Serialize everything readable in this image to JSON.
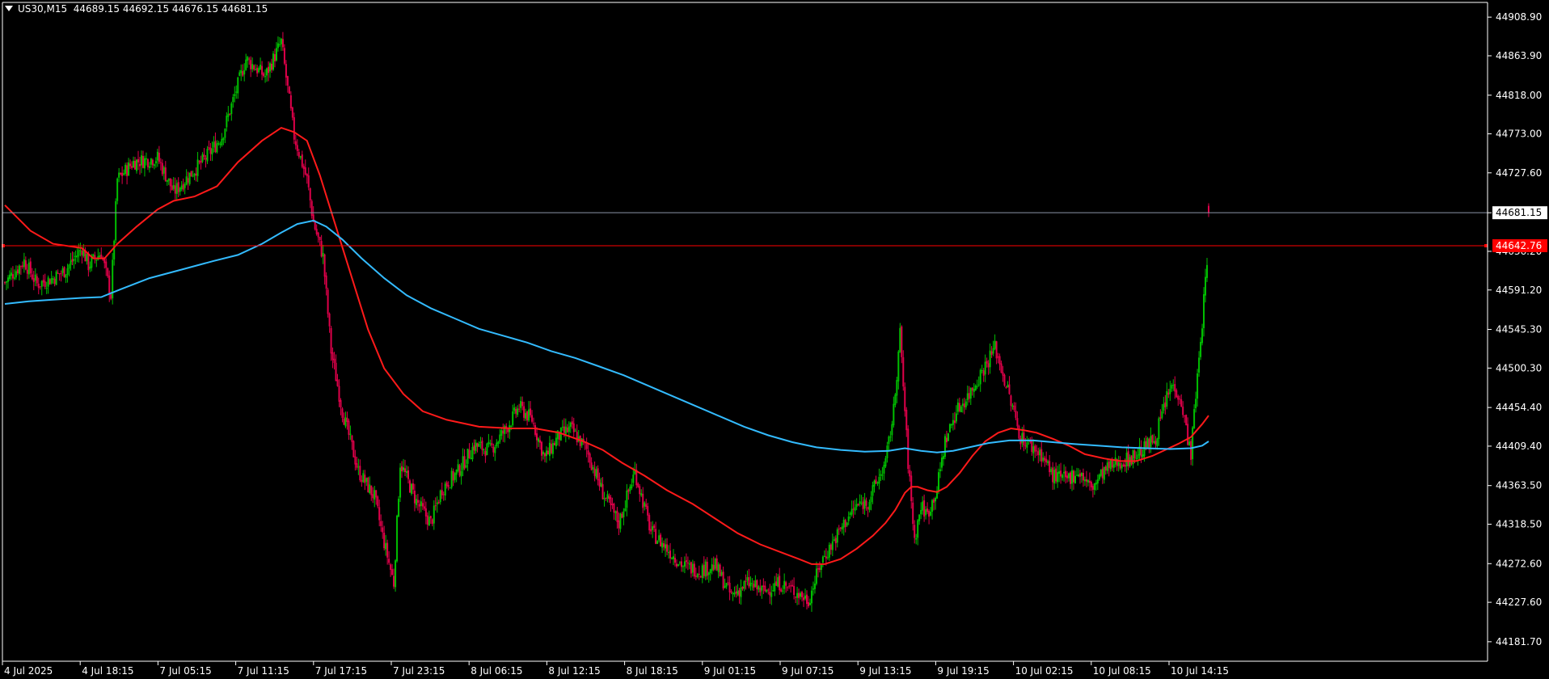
{
  "header": {
    "symbol_timeframe": "US30,M15",
    "ohlc": "44689.15 44692.15 44676.15 44681.15"
  },
  "colors": {
    "background": "#000000",
    "axis": "#ffffff",
    "bull": "#00c000",
    "bear": "#e0004a",
    "ma_fast": "#ff1a1a",
    "ma_slow": "#33bbff",
    "bid_line": "#8b95a8",
    "ask_line": "#ff0000",
    "bid_badge_bg": "#ffffff",
    "bid_badge_text": "#000000",
    "ask_badge_bg": "#ff0000",
    "ask_badge_text": "#ffffff"
  },
  "chart_data": {
    "type": "candlestick",
    "grid": false,
    "ylim": [
      44159.0,
      44926.0
    ],
    "y_ticks": [
      "44908.90",
      "44863.90",
      "44818.00",
      "44773.00",
      "44727.60",
      "44681.15",
      "44636.20",
      "44591.20",
      "44545.30",
      "44500.30",
      "44454.40",
      "44409.40",
      "44363.50",
      "44318.50",
      "44272.60",
      "44227.60",
      "44181.70"
    ],
    "x_ticks": [
      "4 Jul 2025",
      "4 Jul 18:15",
      "7 Jul 05:15",
      "7 Jul 11:15",
      "7 Jul 17:15",
      "7 Jul 23:15",
      "8 Jul 06:15",
      "8 Jul 12:15",
      "8 Jul 18:15",
      "9 Jul 01:15",
      "9 Jul 07:15",
      "9 Jul 13:15",
      "9 Jul 19:15",
      "10 Jul 02:15",
      "10 Jul 08:15",
      "10 Jul 14:15"
    ],
    "bid_price": "44681.15",
    "ask_price": "44642.76",
    "last_candle": {
      "open": 44689.15,
      "high": 44692.15,
      "low": 44676.15,
      "close": 44681.15
    },
    "close_anchors": [
      [
        0,
        44600
      ],
      [
        12,
        44625
      ],
      [
        20,
        44598
      ],
      [
        30,
        44605
      ],
      [
        38,
        44615
      ],
      [
        48,
        44640
      ],
      [
        52,
        44620
      ],
      [
        60,
        44635
      ],
      [
        66,
        44585
      ],
      [
        70,
        44720
      ],
      [
        80,
        44740
      ],
      [
        95,
        44745
      ],
      [
        105,
        44705
      ],
      [
        115,
        44725
      ],
      [
        125,
        44745
      ],
      [
        135,
        44770
      ],
      [
        150,
        44860
      ],
      [
        162,
        44840
      ],
      [
        172,
        44880
      ],
      [
        180,
        44770
      ],
      [
        188,
        44720
      ],
      [
        192,
        44670
      ],
      [
        198,
        44630
      ],
      [
        203,
        44520
      ],
      [
        210,
        44450
      ],
      [
        220,
        44380
      ],
      [
        230,
        44350
      ],
      [
        235,
        44305
      ],
      [
        242,
        44250
      ],
      [
        246,
        44390
      ],
      [
        256,
        44345
      ],
      [
        265,
        44320
      ],
      [
        272,
        44360
      ],
      [
        282,
        44380
      ],
      [
        292,
        44410
      ],
      [
        302,
        44405
      ],
      [
        312,
        44430
      ],
      [
        320,
        44455
      ],
      [
        328,
        44440
      ],
      [
        336,
        44395
      ],
      [
        344,
        44420
      ],
      [
        352,
        44430
      ],
      [
        362,
        44405
      ],
      [
        372,
        44355
      ],
      [
        382,
        44320
      ],
      [
        392,
        44380
      ],
      [
        402,
        44310
      ],
      [
        412,
        44290
      ],
      [
        422,
        44270
      ],
      [
        432,
        44265
      ],
      [
        442,
        44270
      ],
      [
        452,
        44235
      ],
      [
        462,
        44250
      ],
      [
        472,
        44240
      ],
      [
        482,
        44250
      ],
      [
        492,
        44240
      ],
      [
        500,
        44230
      ],
      [
        508,
        44275
      ],
      [
        516,
        44300
      ],
      [
        524,
        44325
      ],
      [
        530,
        44340
      ],
      [
        537,
        44345
      ],
      [
        542,
        44365
      ],
      [
        548,
        44390
      ],
      [
        553,
        44450
      ],
      [
        557,
        44540
      ],
      [
        562,
        44390
      ],
      [
        566,
        44300
      ],
      [
        570,
        44340
      ],
      [
        574,
        44330
      ],
      [
        580,
        44360
      ],
      [
        585,
        44415
      ],
      [
        592,
        44450
      ],
      [
        600,
        44470
      ],
      [
        606,
        44490
      ],
      [
        612,
        44510
      ],
      [
        616,
        44525
      ],
      [
        620,
        44500
      ],
      [
        626,
        44460
      ],
      [
        632,
        44420
      ],
      [
        638,
        44410
      ],
      [
        645,
        44400
      ],
      [
        652,
        44375
      ],
      [
        660,
        44370
      ],
      [
        668,
        44380
      ],
      [
        676,
        44360
      ],
      [
        684,
        44380
      ],
      [
        692,
        44390
      ],
      [
        700,
        44395
      ],
      [
        708,
        44405
      ],
      [
        716,
        44420
      ],
      [
        722,
        44460
      ],
      [
        726,
        44480
      ],
      [
        731,
        44470
      ],
      [
        735,
        44430
      ],
      [
        738,
        44400
      ],
      [
        741,
        44470
      ],
      [
        744,
        44530
      ],
      [
        746,
        44580
      ],
      [
        748,
        44620
      ],
      [
        749,
        44681.15
      ]
    ],
    "series": [
      {
        "name": "",
        "color_key": "ma_fast",
        "points": [
          [
            0,
            44690
          ],
          [
            8,
            44675
          ],
          [
            16,
            44660
          ],
          [
            30,
            44645
          ],
          [
            48,
            44640
          ],
          [
            55,
            44628
          ],
          [
            62,
            44628
          ],
          [
            70,
            44645
          ],
          [
            82,
            44665
          ],
          [
            95,
            44685
          ],
          [
            105,
            44695
          ],
          [
            118,
            44700
          ],
          [
            132,
            44712
          ],
          [
            145,
            44740
          ],
          [
            160,
            44765
          ],
          [
            172,
            44780
          ],
          [
            180,
            44775
          ],
          [
            188,
            44765
          ],
          [
            196,
            44725
          ],
          [
            206,
            44665
          ],
          [
            216,
            44605
          ],
          [
            226,
            44545
          ],
          [
            236,
            44500
          ],
          [
            248,
            44470
          ],
          [
            260,
            44450
          ],
          [
            275,
            44440
          ],
          [
            295,
            44432
          ],
          [
            315,
            44430
          ],
          [
            330,
            44430
          ],
          [
            345,
            44425
          ],
          [
            360,
            44415
          ],
          [
            372,
            44405
          ],
          [
            384,
            44390
          ],
          [
            398,
            44375
          ],
          [
            412,
            44358
          ],
          [
            428,
            44342
          ],
          [
            442,
            44325
          ],
          [
            456,
            44308
          ],
          [
            470,
            44295
          ],
          [
            484,
            44285
          ],
          [
            494,
            44278
          ],
          [
            502,
            44272
          ],
          [
            510,
            44272
          ],
          [
            520,
            44278
          ],
          [
            530,
            44290
          ],
          [
            540,
            44305
          ],
          [
            548,
            44320
          ],
          [
            554,
            44335
          ],
          [
            560,
            44355
          ],
          [
            564,
            44362
          ],
          [
            568,
            44362
          ],
          [
            574,
            44358
          ],
          [
            580,
            44356
          ],
          [
            586,
            44362
          ],
          [
            594,
            44378
          ],
          [
            602,
            44398
          ],
          [
            610,
            44415
          ],
          [
            618,
            44425
          ],
          [
            626,
            44430
          ],
          [
            634,
            44428
          ],
          [
            642,
            44425
          ],
          [
            652,
            44418
          ],
          [
            662,
            44410
          ],
          [
            672,
            44400
          ],
          [
            684,
            44395
          ],
          [
            694,
            44392
          ],
          [
            704,
            44392
          ],
          [
            714,
            44398
          ],
          [
            722,
            44405
          ],
          [
            730,
            44412
          ],
          [
            738,
            44420
          ],
          [
            745,
            44435
          ],
          [
            749,
            44445
          ]
        ]
      },
      {
        "name": "",
        "color_key": "ma_slow",
        "points": [
          [
            0,
            44575
          ],
          [
            15,
            44578
          ],
          [
            30,
            44580
          ],
          [
            48,
            44582
          ],
          [
            60,
            44583
          ],
          [
            72,
            44592
          ],
          [
            90,
            44605
          ],
          [
            110,
            44615
          ],
          [
            130,
            44625
          ],
          [
            145,
            44632
          ],
          [
            160,
            44645
          ],
          [
            172,
            44658
          ],
          [
            182,
            44668
          ],
          [
            192,
            44672
          ],
          [
            200,
            44665
          ],
          [
            210,
            44650
          ],
          [
            222,
            44628
          ],
          [
            236,
            44605
          ],
          [
            250,
            44585
          ],
          [
            265,
            44570
          ],
          [
            280,
            44558
          ],
          [
            295,
            44546
          ],
          [
            310,
            44538
          ],
          [
            325,
            44530
          ],
          [
            340,
            44520
          ],
          [
            355,
            44512
          ],
          [
            370,
            44502
          ],
          [
            385,
            44492
          ],
          [
            400,
            44480
          ],
          [
            415,
            44468
          ],
          [
            430,
            44456
          ],
          [
            445,
            44444
          ],
          [
            460,
            44432
          ],
          [
            475,
            44422
          ],
          [
            490,
            44414
          ],
          [
            505,
            44408
          ],
          [
            520,
            44405
          ],
          [
            535,
            44403
          ],
          [
            550,
            44404
          ],
          [
            560,
            44407
          ],
          [
            570,
            44404
          ],
          [
            580,
            44402
          ],
          [
            590,
            44404
          ],
          [
            600,
            44408
          ],
          [
            612,
            44413
          ],
          [
            625,
            44416
          ],
          [
            640,
            44416
          ],
          [
            652,
            44414
          ],
          [
            665,
            44412
          ],
          [
            680,
            44410
          ],
          [
            695,
            44408
          ],
          [
            710,
            44407
          ],
          [
            725,
            44406
          ],
          [
            738,
            44407
          ],
          [
            745,
            44410
          ],
          [
            749,
            44415
          ]
        ]
      }
    ]
  }
}
